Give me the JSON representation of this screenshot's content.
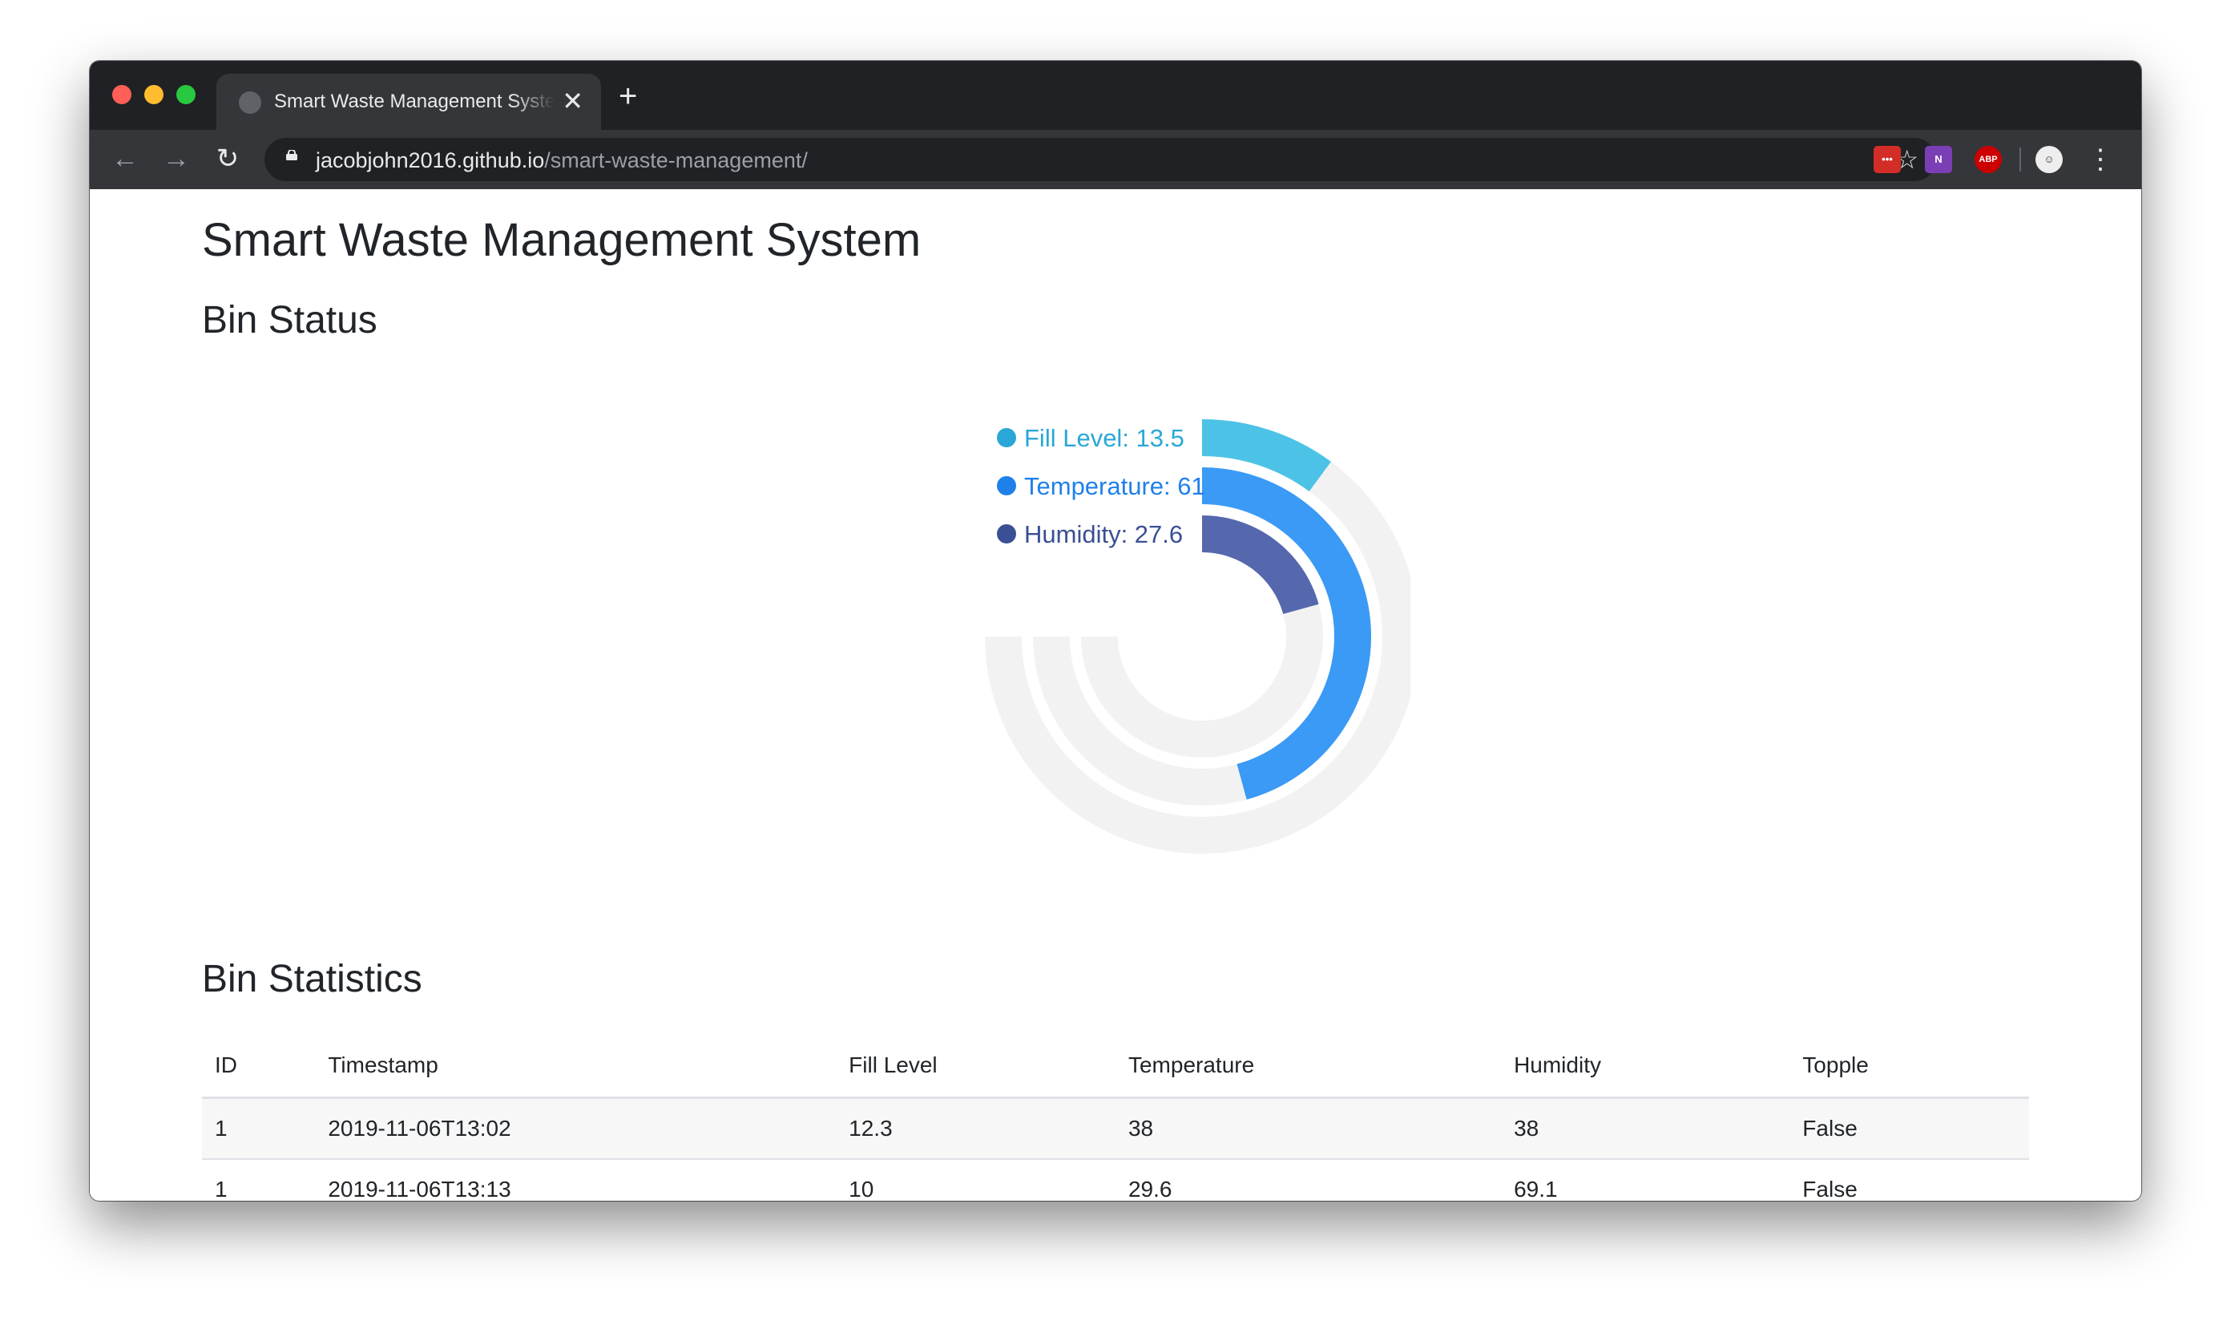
{
  "browser": {
    "tab_title": "Smart Waste Management System",
    "close_glyph": "✕",
    "newtab_glyph": "+",
    "url_host": "jacobjohn2016.github.io",
    "url_path": "/smart-waste-management/",
    "icons": [
      "back-arrow-icon",
      "forward-arrow-icon",
      "reload-icon",
      "lock-icon",
      "star-icon",
      "lastpass-icon",
      "onenote-icon",
      "adblock-icon",
      "profile-icon",
      "menu-icon"
    ],
    "extensions": {
      "lastpass": "•••",
      "onenote": "N",
      "abp": "ABP"
    }
  },
  "page": {
    "title": "Smart Waste Management System",
    "status_heading": "Bin Status",
    "stats_heading": "Bin Statistics"
  },
  "chart_data": {
    "type": "radialBar",
    "max": 100,
    "start_angle_deg": 0,
    "end_angle_deg": 270,
    "legend_position": "left-of-bars",
    "series": [
      {
        "name": "Fill Level",
        "value": 13.5,
        "color": "#4cc3e6",
        "label_color": "#2aa7d6"
      },
      {
        "name": "Temperature",
        "value": 61,
        "color": "#3a9af5",
        "label_color": "#1f80ea"
      },
      {
        "name": "Humidity",
        "value": 27.6,
        "color": "#5568ad",
        "label_color": "#3b4f94"
      }
    ],
    "track_color": "#f2f2f2"
  },
  "table": {
    "headers": [
      "ID",
      "Timestamp",
      "Fill Level",
      "Temperature",
      "Humidity",
      "Topple"
    ],
    "rows": [
      [
        "1",
        "2019-11-06T13:02",
        "12.3",
        "38",
        "38",
        "False"
      ],
      [
        "1",
        "2019-11-06T13:13",
        "10",
        "29.6",
        "69.1",
        "False"
      ]
    ]
  }
}
